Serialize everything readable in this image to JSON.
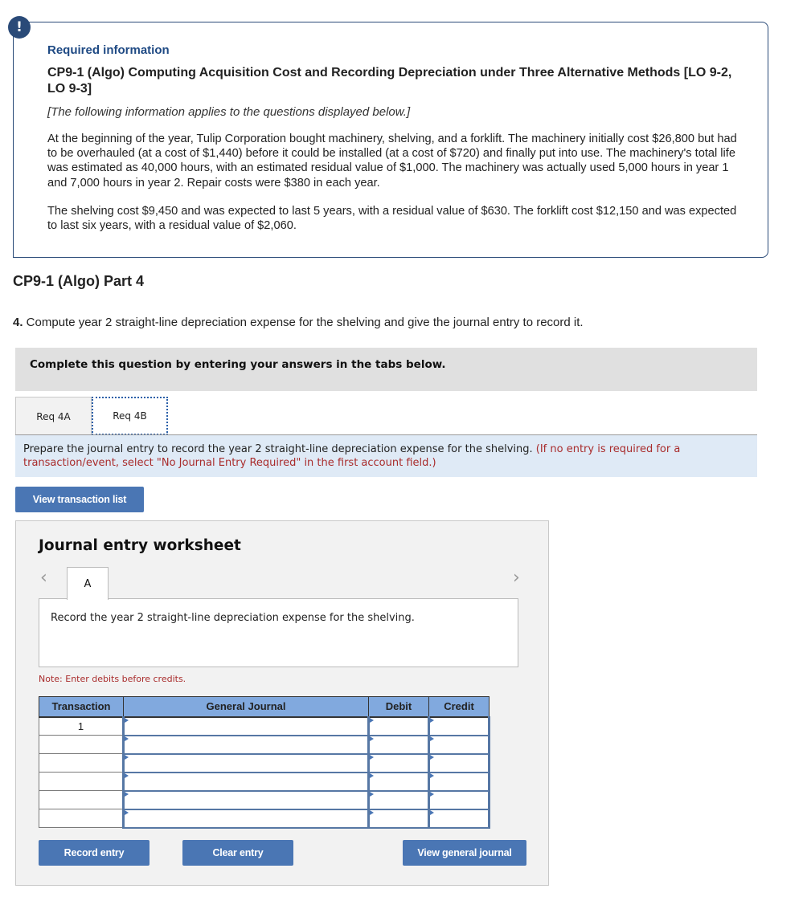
{
  "info": {
    "alert_icon": "!",
    "required_label": "Required information",
    "problem_title": "CP9-1 (Algo) Computing Acquisition Cost and Recording Depreciation under Three Alternative Methods [LO 9-2, LO 9-3]",
    "applies_note": "[The following information applies to the questions displayed below.]",
    "paragraphs": [
      "At the beginning of the year, Tulip Corporation bought machinery, shelving, and a forklift. The machinery initially cost $26,800 but had to be overhauled (at a cost of $1,440) before it could be installed (at a cost of $720) and finally put into use. The machinery's total life was estimated as 40,000 hours, with an estimated residual value of $1,000. The machinery was actually used 5,000 hours in year 1 and 7,000 hours in year 2. Repair costs were $380 in each year.",
      "The shelving cost $9,450 and was expected to last 5 years, with a residual value of $630. The forklift cost $12,150 and was expected to last six years, with a residual value of $2,060."
    ]
  },
  "part_title": "CP9-1 (Algo) Part 4",
  "question": {
    "number": "4.",
    "text": " Compute year 2 straight-line depreciation expense for the shelving and give the journal entry to record it."
  },
  "instruction": "Complete this question by entering your answers in the tabs below.",
  "tabs": [
    {
      "label": "Req 4A",
      "active": false
    },
    {
      "label": "Req 4B",
      "active": true
    }
  ],
  "prompt": {
    "text": "Prepare the journal entry to record the year 2 straight-line depreciation expense for the shelving. ",
    "hint": "(If no entry is required for a transaction/event, select \"No Journal Entry Required\" in the first account field.)"
  },
  "buttons": {
    "view_transaction_list": "View transaction list",
    "record_entry": "Record entry",
    "clear_entry": "Clear entry",
    "view_general_journal": "View general journal"
  },
  "worksheet": {
    "title": "Journal entry worksheet",
    "prev_icon": "‹",
    "next_icon": "›",
    "entry_tab": "A",
    "entry_description": "Record the year 2 straight-line depreciation expense for the shelving.",
    "note": "Note: Enter debits before credits.",
    "table": {
      "headers": [
        "Transaction",
        "General Journal",
        "Debit",
        "Credit"
      ],
      "rows": [
        {
          "transaction": "1",
          "account": "",
          "debit": "",
          "credit": ""
        },
        {
          "transaction": "",
          "account": "",
          "debit": "",
          "credit": ""
        },
        {
          "transaction": "",
          "account": "",
          "debit": "",
          "credit": ""
        },
        {
          "transaction": "",
          "account": "",
          "debit": "",
          "credit": ""
        },
        {
          "transaction": "",
          "account": "",
          "debit": "",
          "credit": ""
        },
        {
          "transaction": "",
          "account": "",
          "debit": "",
          "credit": ""
        }
      ]
    }
  },
  "colors": {
    "accent": "#4a76b4",
    "header_blue": "#81a9de",
    "navy": "#2a4a78",
    "hint_red": "#a92c2c"
  }
}
